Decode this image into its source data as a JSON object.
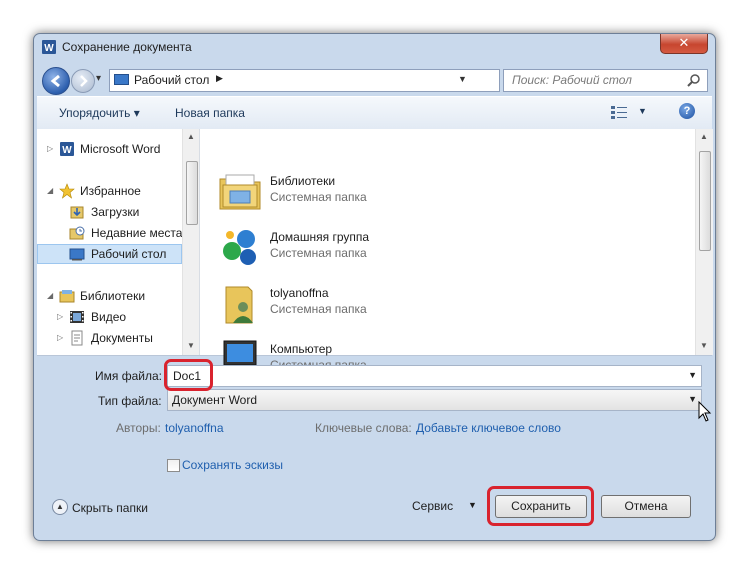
{
  "window": {
    "title": "Сохранение документа",
    "close_label": "✕"
  },
  "address": {
    "path_label": "Рабочий стол",
    "search_placeholder": "Поиск: Рабочий стол"
  },
  "toolbar": {
    "organize_label": "Упорядочить ▾",
    "new_folder_label": "Новая папка",
    "help_label": "?"
  },
  "nav_pane": {
    "items": [
      {
        "label": "Microsoft Word",
        "icon": "word-icon"
      },
      {
        "label": "Избранное",
        "icon": "star-icon"
      },
      {
        "label": "Загрузки",
        "icon": "downloads-icon"
      },
      {
        "label": "Недавние места",
        "icon": "recent-places-icon"
      },
      {
        "label": "Рабочий стол",
        "icon": "desktop-icon",
        "selected": true
      },
      {
        "label": "Библиотеки",
        "icon": "libraries-icon"
      },
      {
        "label": "Видео",
        "icon": "video-icon"
      },
      {
        "label": "Документы",
        "icon": "documents-icon"
      }
    ]
  },
  "files": [
    {
      "name": "Библиотеки",
      "type": "Системная папка",
      "icon": "libraries-folder-icon"
    },
    {
      "name": "Домашняя группа",
      "type": "Системная папка",
      "icon": "homegroup-icon"
    },
    {
      "name": "tolyanoffna",
      "type": "Системная папка",
      "icon": "user-folder-icon"
    },
    {
      "name": "Компьютер",
      "type": "Системная папка",
      "icon": "computer-icon"
    }
  ],
  "form": {
    "filename_label": "Имя файла:",
    "filename_value": "Doc1",
    "filetype_label": "Тип файла:",
    "filetype_value": "Документ Word",
    "authors_label": "Авторы:",
    "authors_value": "tolyanoffna",
    "keywords_label": "Ключевые слова:",
    "keywords_value": "Добавьте ключевое слово",
    "thumbnails_label": "Сохранять эскизы",
    "thumbnails_checked": false
  },
  "footer": {
    "hide_folders_label": "Скрыть папки",
    "tools_label": "Сервис",
    "save_label": "Сохранить",
    "cancel_label": "Отмена"
  },
  "colors": {
    "highlight_ring": "#d9232e",
    "link": "#1f5fae",
    "window_frame": "#c9d9ec"
  }
}
